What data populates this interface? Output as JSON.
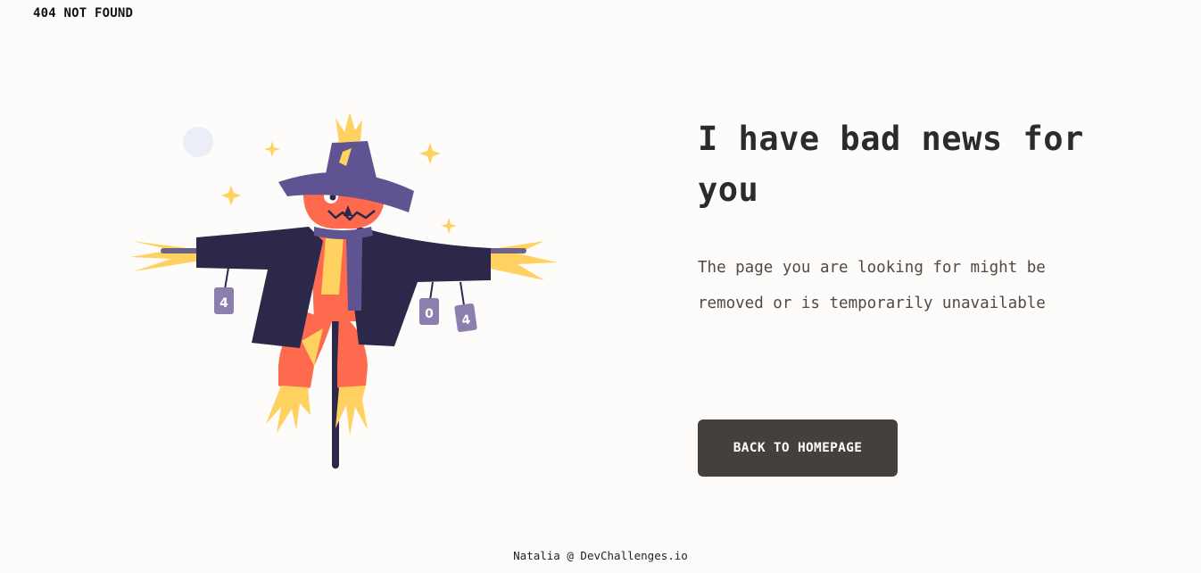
{
  "header": {
    "brand": "404 NOT FOUND"
  },
  "illustration": {
    "name": "scarecrow-illustration",
    "can_digits": [
      "4",
      "0",
      "4"
    ]
  },
  "main": {
    "headline": "I have bad news for you",
    "message": "The page you are looking for might be removed or is temporarily unavailable",
    "cta_label": "BACK TO HOMEPAGE"
  },
  "footer": {
    "credit": "Natalia @ DevChallenges.io"
  },
  "colors": {
    "background": "#fdfcfb",
    "button": "#45403c",
    "coat": "#2c2849",
    "hat": "#605391",
    "skin": "#fe6a4e",
    "straw": "#fed161",
    "cans": "#8b7fae"
  }
}
